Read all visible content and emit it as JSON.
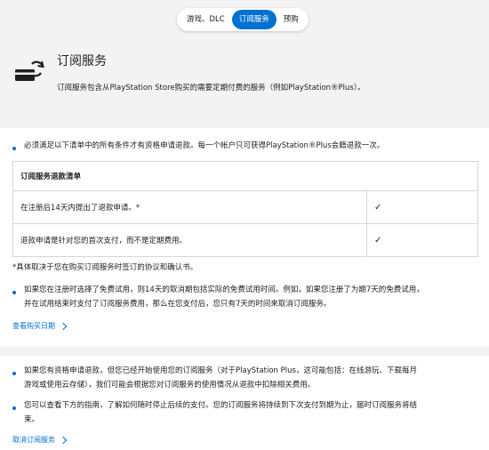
{
  "tabs": [
    {
      "label": "游戏、DLC"
    },
    {
      "label": "订阅服务"
    },
    {
      "label": "预购"
    }
  ],
  "subscription": {
    "title": "订阅服务",
    "description": "订阅服务包含从PlayStation Store购买的需要定期付费的服务（例如PlayStation®Plus）。",
    "icon": "subscription-card-refresh-icon"
  },
  "bullets": {
    "eligibility": "必须满足以下清单中的所有条件才有资格申请退款。每一个帐户只可获得PlayStation®Plus会籍退款一次。",
    "free_trial": [
      "如果您在注册时选择了免费试用，则14天的取消期包括实际的免费试用时间。例如，如果您注册了为期7天的免费试用，",
      "并在试用结束时支付了订阅服务费用，那么在您支付后，您只有7天的时间来取消订阅服务。"
    ],
    "used_service": [
      "如果您有资格申请退款，但您已经开始使用您的订阅服务（对于PlayStation Plus，这可能包括：在线游玩、下载每月",
      "游戏或使用云存储），我们可能会根据您对订阅服务的使用情况从退款中扣除相关费用。"
    ],
    "cancel_guide": [
      "您可以查看下方的指南，了解如何随时停止后续的支付。您的订阅服务将持续到下次支付到期为止，届时订阅服务将结",
      "束。"
    ]
  },
  "checklist": {
    "header": "订阅服务退款清单",
    "rows": [
      {
        "text": "在注册后14天内提出了退款申请。*",
        "check": "✓"
      },
      {
        "text": "退款申请是针对您的首次支付，而不是定期费用。",
        "check": "✓"
      }
    ]
  },
  "note": "*具体取决于您在购买订阅服务时签订的协议和确认书。",
  "links": {
    "purchase_date": "查看购买日期",
    "cancel_subscription": "取消订阅服务"
  },
  "colors": {
    "accent": "#0070d1",
    "band": "#f3f3f3"
  }
}
